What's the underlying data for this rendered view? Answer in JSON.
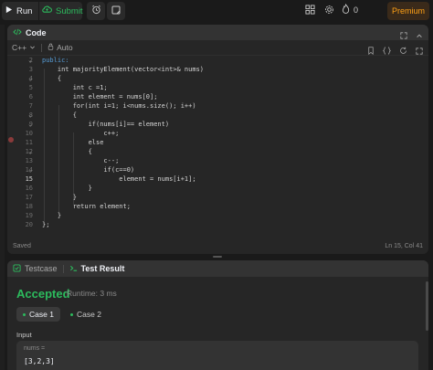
{
  "toolbar": {
    "run_label": "Run",
    "submit_label": "Submit",
    "streak_count": "0",
    "premium_label": "Premium"
  },
  "code_panel": {
    "title": "Code",
    "language": "C++",
    "mode": "Auto",
    "saved_label": "Saved",
    "cursor_position": "Ln 15, Col 41"
  },
  "code_lines": [
    {
      "num": "2",
      "text": "public:"
    },
    {
      "num": "3",
      "text": "    int majorityElement(vector<int>& nums)"
    },
    {
      "num": "4",
      "text": "    {"
    },
    {
      "num": "5",
      "text": "        int c =1;"
    },
    {
      "num": "6",
      "text": "        int element = nums[0];"
    },
    {
      "num": "7",
      "text": "        for(int i=1; i<nums.size(); i++)"
    },
    {
      "num": "8",
      "text": "        {"
    },
    {
      "num": "9",
      "text": "            if(nums[i]== element)"
    },
    {
      "num": "10",
      "text": "                c++;"
    },
    {
      "num": "11",
      "text": "            else"
    },
    {
      "num": "12",
      "text": "            {"
    },
    {
      "num": "13",
      "text": "                c--;"
    },
    {
      "num": "14",
      "text": "                if(c==0)"
    },
    {
      "num": "15",
      "text": "                    element = nums[i+1];"
    },
    {
      "num": "16",
      "text": "            }"
    },
    {
      "num": "17",
      "text": "        }"
    },
    {
      "num": "18",
      "text": "        return element;"
    },
    {
      "num": "19",
      "text": "    }"
    },
    {
      "num": "20",
      "text": "};"
    }
  ],
  "test_panel": {
    "tab_testcase": "Testcase",
    "tab_result": "Test Result",
    "status": "Accepted",
    "runtime": "Runtime: 3 ms",
    "case1_label": "Case 1",
    "case2_label": "Case 2",
    "input_label": "Input",
    "input_var": "nums =",
    "input_value": "[3,2,3]"
  },
  "colors": {
    "accent_green": "#2cbb5d",
    "premium_orange": "#ffa116",
    "panel_bg": "#262626",
    "page_bg": "#1a1a1a"
  },
  "icons": {
    "run": "play-icon",
    "submit": "cloud-upload-icon",
    "timer": "alarm-clock-icon",
    "notes": "note-icon",
    "layout": "layout-grid-icon",
    "settings": "gear-icon",
    "streak": "fire-icon",
    "code": "code-icon"
  }
}
